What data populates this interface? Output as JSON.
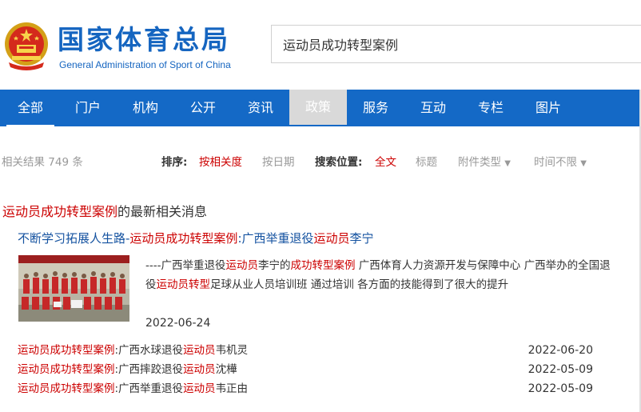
{
  "header": {
    "logo_cn": "国家体育总局",
    "logo_en": "General Administration of Sport of China",
    "search_value": "运动员成功转型案例"
  },
  "nav": {
    "items": [
      "全部",
      "门户",
      "机构",
      "公开",
      "资讯",
      "政策",
      "服务",
      "互动",
      "专栏",
      "图片"
    ],
    "active_index": 5,
    "colors": {
      "bar": "#1469c6",
      "active": "#d9d9d9"
    }
  },
  "filters": {
    "result_count": "相关结果 749 条",
    "sort_label": "排序:",
    "sort_relevance": "按相关度",
    "sort_date": "按日期",
    "search_pos_label": "搜索位置:",
    "pos_all": "全文",
    "pos_title": "标题",
    "attachment_type": "附件类型",
    "time_limit": "时间不限"
  },
  "section": {
    "keyword": "运动员成功转型案例",
    "suffix": "的最新相关消息"
  },
  "featured": {
    "title_prefix": "不断学习拓展人生路-",
    "title_keyword": "运动员成功转型案例",
    "title_mid": ":广西举重退役",
    "title_kw2": "运动员",
    "title_end": "李宁",
    "summary_parts": [
      {
        "t": "----广西举重退役",
        "hl": false
      },
      {
        "t": "运动员",
        "hl": true
      },
      {
        "t": "李宁的",
        "hl": false
      },
      {
        "t": "成功转型案例",
        "hl": true
      },
      {
        "t": " 广西体育人力资源开发与保障中心 广西举办的全国退役",
        "hl": false
      },
      {
        "t": "运动员转型",
        "hl": true
      },
      {
        "t": "足球从业人员培训班 通过培训 各方面的技能得到了很大的提升",
        "hl": false
      }
    ],
    "date": "2022-06-24"
  },
  "list": [
    {
      "kw": "运动员成功转型案例",
      "mid": ":广西水球退役",
      "kw2": "运动员",
      "end": "韦机灵",
      "date": "2022-06-20"
    },
    {
      "kw": "运动员成功转型案例",
      "mid": ":广西摔跤退役",
      "kw2": "运动员",
      "end": "沈樺",
      "date": "2022-05-09"
    },
    {
      "kw": "运动员成功转型案例",
      "mid": ":广西举重退役",
      "kw2": "运动员",
      "end": "韦正由",
      "date": "2022-05-09"
    }
  ],
  "colors": {
    "brand": "#1565c0",
    "highlight": "#cc0000",
    "link": "#1452a0"
  }
}
